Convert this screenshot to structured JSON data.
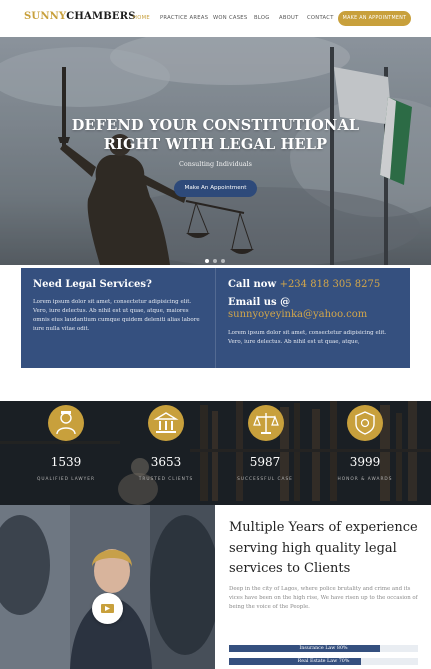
{
  "brand": {
    "part1": "SUNNY",
    "part2": "CHAMBERS"
  },
  "nav": {
    "items": [
      "HOME",
      "PRACTICE AREAS",
      "WON CASES",
      "BLOG",
      "ABOUT",
      "CONTACT"
    ],
    "cta": "MAKE AN APPOINTMENT",
    "active_color": "#c8a03c"
  },
  "hero": {
    "title": "DEFEND YOUR CONSTITUTIONAL RIGHT WITH LEGAL HELP",
    "subtitle": "Consulting Individuals",
    "button": "Make An Appointment",
    "slides": 3,
    "active_slide": 1
  },
  "info": {
    "left_heading": "Need Legal Services?",
    "left_text": "Lorem ipsum dolor sit amet, consectetur adipisicing elit. Vero, iure delectus. Ab nihil est ut quae, atque, maiores omnis eius laudantium cumque quidem deleniti alias labore iure nulla vitae odit.",
    "call_label": "Call now",
    "phone": "+234 818 305 8275",
    "email_label": "Email us @",
    "email": "sunnyoyeyinka@yahoo.com",
    "right_text": "Lorem ipsum dolor sit amet, consectetur adipisicing elit. Vero, iure delectus. Ab nihil est ut quae, atque,"
  },
  "stats": [
    {
      "icon": "lawyer-icon",
      "number": "1539",
      "label": "QUALIFIED LAWYER"
    },
    {
      "icon": "bank-icon",
      "number": "3653",
      "label": "TRUSTED CLIENTS"
    },
    {
      "icon": "scales-icon",
      "number": "5987",
      "label": "SUCCESSFUL CASE"
    },
    {
      "icon": "award-icon",
      "number": "3999",
      "label": "HONOR & AWARDS"
    }
  ],
  "experience": {
    "title": "Multiple Years of experience serving high quality legal services to Clients",
    "text": "Deep in the city of Lagos, where police brutality and crime and its vices have been on the high rise, We have risen up to the occasion of being the voice of the People.",
    "bars": [
      {
        "label": "Insurance Law 80%",
        "percent": 80
      },
      {
        "label": "Real Estate Law 70%",
        "percent": 70
      }
    ]
  },
  "colors": {
    "gold": "#c8a03c",
    "navy": "#35507f",
    "dark": "#15191d"
  }
}
